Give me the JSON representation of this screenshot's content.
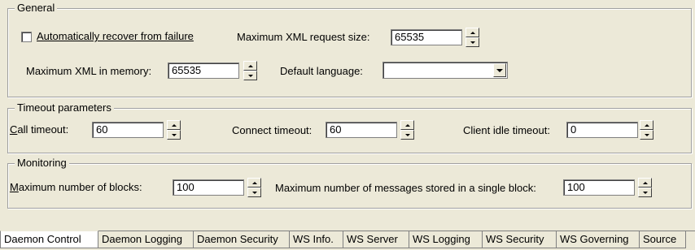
{
  "general": {
    "title": "General",
    "auto_recover": {
      "label": "Automatically recover from failure",
      "checked": false
    },
    "max_xml_request": {
      "label": "Maximum XML request size:",
      "value": "65535"
    },
    "max_xml_memory": {
      "label": "Maximum XML in memory:",
      "value": "65535"
    },
    "default_language": {
      "label": "Default language:",
      "value": ""
    }
  },
  "timeout": {
    "title": "Timeout parameters",
    "call": {
      "label_u": "C",
      "label_rest": "all timeout:",
      "value": "60"
    },
    "connect": {
      "label": "Connect timeout:",
      "value": "60"
    },
    "client_idle": {
      "label": "Client idle timeout:",
      "value": "0"
    }
  },
  "monitoring": {
    "title": "Monitoring",
    "max_blocks": {
      "label_u": "M",
      "label_rest": "aximum number of blocks:",
      "value": "100"
    },
    "max_messages": {
      "label": "Maximum number of messages stored in a single block:",
      "value": "100"
    }
  },
  "tabs": [
    {
      "label": "Daemon Control",
      "active": true
    },
    {
      "label": "Daemon Logging"
    },
    {
      "label": "Daemon Security"
    },
    {
      "label": "WS Info."
    },
    {
      "label": "WS Server"
    },
    {
      "label": "WS Logging"
    },
    {
      "label": "WS Security"
    },
    {
      "label": "WS Governing"
    },
    {
      "label": "Source"
    }
  ]
}
